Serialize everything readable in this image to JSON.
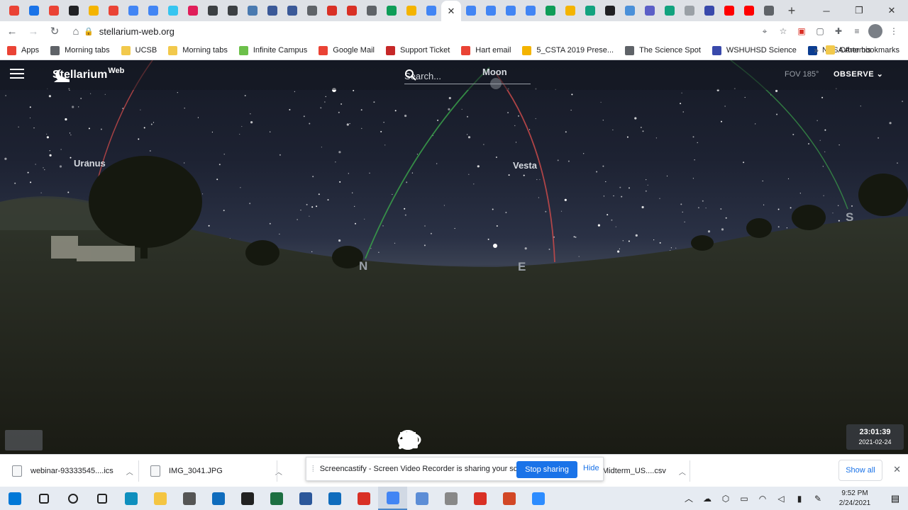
{
  "browser": {
    "tabs": [
      {
        "icon": "gmail-icon",
        "color": "#ea4335"
      },
      {
        "icon": "edge-icon",
        "color": "#1a73e8"
      },
      {
        "icon": "gmail-icon",
        "color": "#ea4335"
      },
      {
        "icon": "classroom-icon",
        "color": "#202124"
      },
      {
        "icon": "slides-icon",
        "color": "#f4b400"
      },
      {
        "icon": "gmail-icon",
        "color": "#ea4335"
      },
      {
        "icon": "docs-icon",
        "color": "#4285f4"
      },
      {
        "icon": "docs-icon",
        "color": "#4285f4"
      },
      {
        "icon": "slack-icon",
        "color": "#36c5f0"
      },
      {
        "icon": "slack-icon",
        "color": "#e01e5a"
      },
      {
        "icon": "site-icon",
        "color": "#3c4043"
      },
      {
        "icon": "site-icon",
        "color": "#3c4043"
      },
      {
        "icon": "image-icon",
        "color": "#4a7ab0"
      },
      {
        "icon": "site-icon",
        "color": "#3b5998"
      },
      {
        "icon": "site-icon",
        "color": "#3b5998"
      },
      {
        "icon": "globe-icon",
        "color": "#5f6368"
      },
      {
        "icon": "site-icon",
        "color": "#d93025"
      },
      {
        "icon": "site-icon",
        "color": "#d93025"
      },
      {
        "icon": "globe-icon",
        "color": "#5f6368"
      },
      {
        "icon": "drive-icon",
        "color": "#0f9d58"
      },
      {
        "icon": "drive-icon",
        "color": "#f4b400"
      },
      {
        "icon": "docs-icon",
        "color": "#4285f4"
      },
      {
        "icon": "close-icon",
        "color": "#333333",
        "active": true
      },
      {
        "icon": "docs-icon",
        "color": "#4285f4"
      },
      {
        "icon": "docs-icon",
        "color": "#4285f4"
      },
      {
        "icon": "docs-icon",
        "color": "#4285f4"
      },
      {
        "icon": "docs-icon",
        "color": "#4285f4"
      },
      {
        "icon": "drive-icon",
        "color": "#0f9d58"
      },
      {
        "icon": "drive-icon",
        "color": "#f4b400"
      },
      {
        "icon": "site-icon",
        "color": "#12a37f"
      },
      {
        "icon": "site-icon",
        "color": "#202124"
      },
      {
        "icon": "site-icon",
        "color": "#4a90d9"
      },
      {
        "icon": "teams-icon",
        "color": "#5b5fc7"
      },
      {
        "icon": "site-icon",
        "color": "#12a37f"
      },
      {
        "icon": "site-icon",
        "color": "#9aa0a6"
      },
      {
        "icon": "site-icon",
        "color": "#3949ab"
      },
      {
        "icon": "youtube-icon",
        "color": "#ff0000"
      },
      {
        "icon": "youtube-icon",
        "color": "#ff0000"
      },
      {
        "icon": "globe-icon",
        "color": "#5f6368"
      }
    ],
    "new_tab": "+",
    "window_controls": {
      "minimize": "─",
      "maximize": "❐",
      "close": "✕"
    },
    "url": "stellarium-web.org",
    "bookmarks": [
      {
        "label": "Apps",
        "color": "#ea4335"
      },
      {
        "label": "Morning tabs",
        "color": "#5f6368"
      },
      {
        "label": "UCSB",
        "color": "#f2c94c"
      },
      {
        "label": "Morning tabs",
        "color": "#f2c94c"
      },
      {
        "label": "Infinite Campus",
        "color": "#6cc04a"
      },
      {
        "label": "Google Mail",
        "color": "#ea4335"
      },
      {
        "label": "Support Ticket",
        "color": "#c62828"
      },
      {
        "label": "Hart email",
        "color": "#ea4335"
      },
      {
        "label": "5_CSTA 2019 Prese...",
        "color": "#f4b400"
      },
      {
        "label": "The Science Spot",
        "color": "#5f6368"
      },
      {
        "label": "WSHUHSD Science",
        "color": "#3949ab"
      },
      {
        "label": "NASA Artemis",
        "color": "#0b3d91"
      }
    ],
    "bookmarks_more": "»",
    "other_bookmarks": "Other bookmarks"
  },
  "stellarium": {
    "brand": "Stellarium",
    "brand_sup": "Web",
    "search_placeholder": "Search...",
    "fov": "FOV 185°",
    "mode": "OBSERVE",
    "labels": {
      "moon": "Moon",
      "uranus": "Uranus",
      "vesta": "Vesta"
    },
    "cardinals": {
      "north": "N",
      "east": "E",
      "south": "S"
    },
    "time": "23:01:39",
    "date": "2021-02-24",
    "controls": [
      "constellation-lines-icon",
      "constellation-art-icon",
      "atmosphere-icon",
      "landscape-icon",
      "azimuthal-grid-icon",
      "equatorial-grid-icon",
      "deep-sky-icon",
      "night-mode-icon",
      "fullscreen-icon"
    ]
  },
  "downloads": {
    "items": [
      "webinar-93333545....ics",
      "IMG_3041.JPG",
      "Midterm_US....csv"
    ],
    "show_all": "Show all",
    "close": "✕"
  },
  "screencastify": {
    "message": "Screencastify - Screen Video Recorder is sharing your screen.",
    "stop": "Stop sharing",
    "hide": "Hide"
  },
  "taskbar": {
    "apps": [
      {
        "name": "windows-start-icon",
        "color": "#0078d7"
      },
      {
        "name": "search-icon",
        "color": "#222222"
      },
      {
        "name": "cortana-icon",
        "color": "#222222"
      },
      {
        "name": "task-view-icon",
        "color": "#222222"
      },
      {
        "name": "edge-icon",
        "color": "#0f8fbe"
      },
      {
        "name": "file-explorer-icon",
        "color": "#f4c542"
      },
      {
        "name": "store-icon",
        "color": "#555555"
      },
      {
        "name": "mail-icon",
        "color": "#0f6cbd"
      },
      {
        "name": "app-icon",
        "color": "#222222"
      },
      {
        "name": "excel-icon",
        "color": "#1d6f42"
      },
      {
        "name": "word-icon",
        "color": "#2b579a"
      },
      {
        "name": "photos-icon",
        "color": "#0f6cbd"
      },
      {
        "name": "acrobat-icon",
        "color": "#d93025"
      },
      {
        "name": "chrome-icon",
        "color": "#4285f4",
        "active": true
      },
      {
        "name": "app-icon",
        "color": "#5c8dd6"
      },
      {
        "name": "app-icon",
        "color": "#888888"
      },
      {
        "name": "app-icon",
        "color": "#d93025"
      },
      {
        "name": "powerpoint-icon",
        "color": "#d24726"
      },
      {
        "name": "zoom-icon",
        "color": "#2d8cff"
      }
    ],
    "clock_time": "9:52 PM",
    "clock_date": "2/24/2021"
  }
}
